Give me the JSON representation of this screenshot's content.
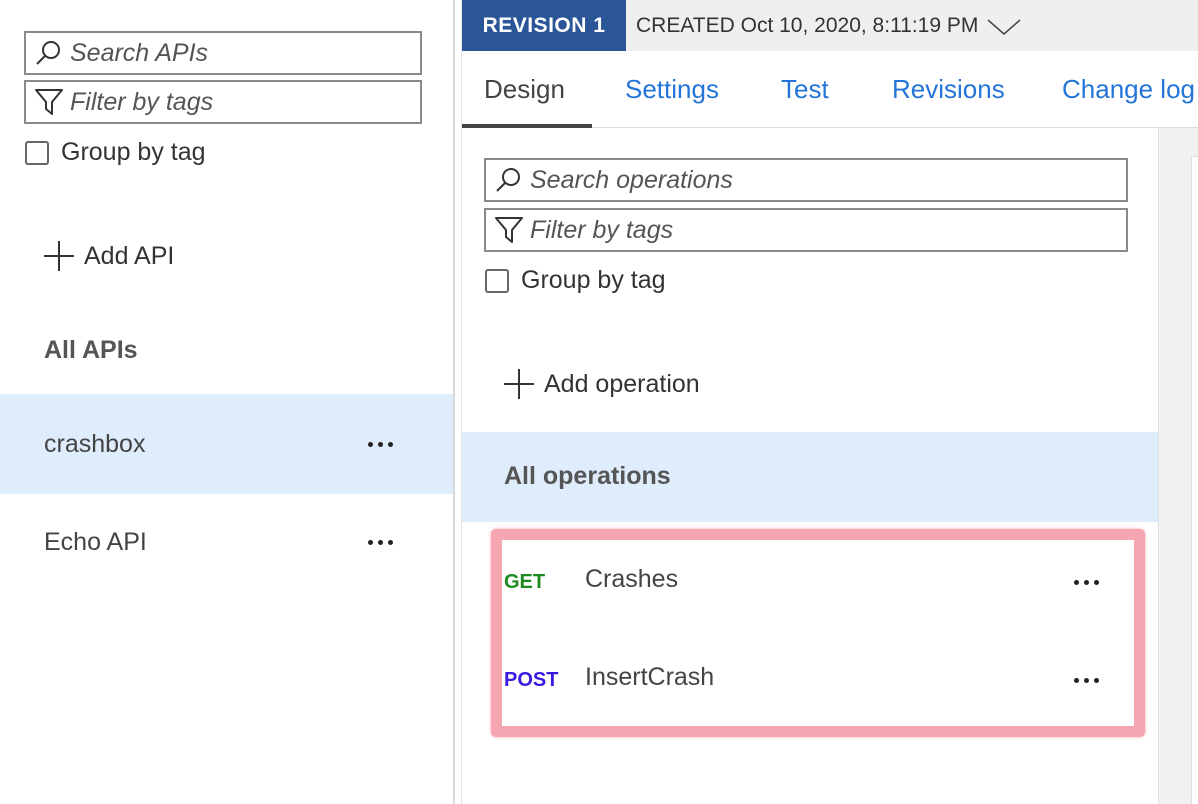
{
  "left": {
    "search_placeholder": "Search APIs",
    "filter_placeholder": "Filter by tags",
    "group_by_tag": "Group by tag",
    "add_api": "Add API",
    "all_apis": "All APIs",
    "apis": [
      {
        "name": "crashbox",
        "selected": true
      },
      {
        "name": "Echo API",
        "selected": false
      }
    ]
  },
  "revision": {
    "badge": "REVISION 1",
    "created": "CREATED Oct 10, 2020, 8:11:19 PM"
  },
  "tabs": [
    {
      "label": "Design",
      "active": true
    },
    {
      "label": "Settings",
      "active": false
    },
    {
      "label": "Test",
      "active": false
    },
    {
      "label": "Revisions",
      "active": false
    },
    {
      "label": "Change log",
      "active": false
    }
  ],
  "operations": {
    "search_placeholder": "Search operations",
    "filter_placeholder": "Filter by tags",
    "group_by_tag": "Group by tag",
    "add_operation": "Add operation",
    "all_operations": "All operations",
    "items": [
      {
        "method": "GET",
        "method_color": "#1f8a1f",
        "name": "Crashes"
      },
      {
        "method": "POST",
        "method_color": "#3a19e0",
        "name": "InsertCrash"
      }
    ]
  },
  "colors": {
    "accent_blue": "#2575d8",
    "revision_badge": "#2a5597",
    "selected_row": "#deecfb",
    "highlight": "#f6a6b1"
  },
  "icons": {
    "search": "search-icon",
    "filter": "filter-icon",
    "add": "plus-icon",
    "more": "ellipsis-icon",
    "dropdown": "chevron-down-icon"
  }
}
